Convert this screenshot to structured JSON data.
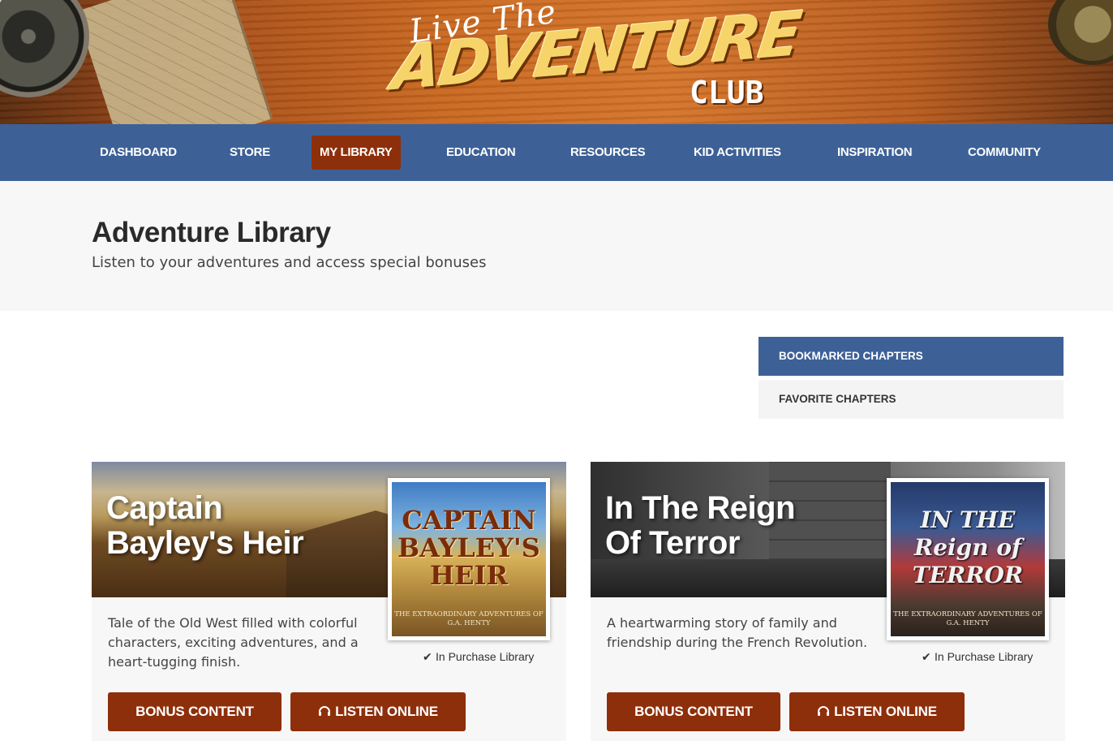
{
  "brand": {
    "line1": "Live The",
    "line2": "ADVENTURE",
    "line3": "CLUB"
  },
  "nav": {
    "items": [
      {
        "label": "DASHBOARD"
      },
      {
        "label": "STORE"
      },
      {
        "label": "MY LIBRARY",
        "active": true
      },
      {
        "label": "EDUCATION"
      },
      {
        "label": "RESOURCES"
      },
      {
        "label": "KID ACTIVITIES"
      },
      {
        "label": "INSPIRATION"
      },
      {
        "label": "COMMUNITY"
      }
    ]
  },
  "header": {
    "title": "Adventure Library",
    "subtitle": "Listen to your adventures and access special bonuses"
  },
  "tabs": {
    "bookmarked": "BOOKMARKED CHAPTERS",
    "favorite": "FAVORITE CHAPTERS"
  },
  "cards": [
    {
      "title_line1": "Captain",
      "title_line2": "Bayley's Heir",
      "cover_title": "CAPTAIN BAYLEY'S HEIR",
      "cover_byline": "THE EXTRAORDINARY ADVENTURES OF G.A. HENTY",
      "description": "Tale of the Old West filled with colorful characters, exciting adventures, and a heart-tugging finish.",
      "status": "In Purchase Library",
      "bonus_label": "BONUS CONTENT",
      "listen_label": "LISTEN ONLINE"
    },
    {
      "title_line1": "In The Reign",
      "title_line2": "Of Terror",
      "cover_title": "IN THE Reign of TERROR",
      "cover_byline": "THE EXTRAORDINARY ADVENTURES OF G.A. HENTY",
      "description": "A heartwarming story of family and friendship during the French Revolution.",
      "status": "In Purchase Library",
      "bonus_label": "BONUS CONTENT",
      "listen_label": "LISTEN ONLINE"
    }
  ],
  "colors": {
    "nav_bg": "#3d6197",
    "accent": "#8e2f0b",
    "band_bg": "#f7f7f7"
  },
  "icons": {
    "check": "check-icon",
    "headphones": "headphones-icon"
  }
}
